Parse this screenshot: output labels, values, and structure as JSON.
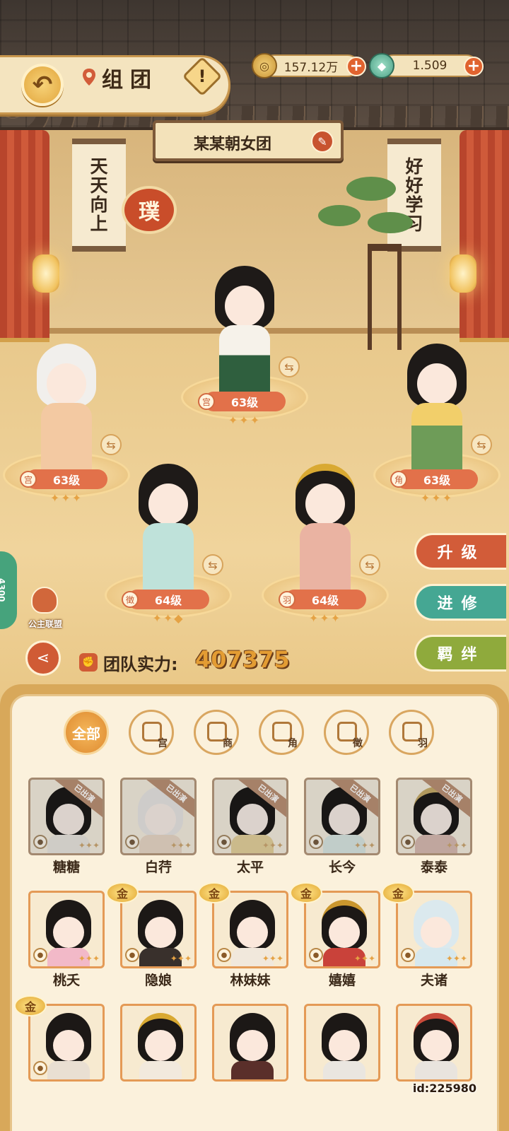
{
  "header": {
    "title": "组团",
    "help_symbol": "!",
    "back_symbol": "↶"
  },
  "resources": {
    "coin": {
      "value": "157.12万",
      "icon": "coin-icon"
    },
    "jade": {
      "value": "1.509",
      "icon": "jade-icon"
    },
    "plus": "+"
  },
  "team": {
    "name": "某某朝女团",
    "edit_icon": "brush-icon"
  },
  "decor": {
    "scroll_left": [
      "天",
      "天",
      "向",
      "上"
    ],
    "scroll_right": [
      "好",
      "好",
      "学",
      "习"
    ],
    "seal": "璞"
  },
  "members": [
    {
      "level": "63级",
      "role": "宫",
      "stars": "✦✦✦"
    },
    {
      "level": "63级",
      "role": "宫",
      "stars": "✦✦✦"
    },
    {
      "level": "63级",
      "role": "角",
      "stars": "✦✦✦"
    },
    {
      "level": "64级",
      "role": "徵",
      "stars": "✦✦◆"
    },
    {
      "level": "64级",
      "role": "羽",
      "stars": "✦✦✦"
    }
  ],
  "actions": {
    "upgrade": "升级",
    "advance": "进修",
    "bond": "羁绊"
  },
  "side": {
    "left_tab": "4300",
    "alliance": "公主联盟"
  },
  "power": {
    "label": "团队实力:",
    "value": "407375"
  },
  "filters": [
    {
      "label": "全部",
      "sub": ""
    },
    {
      "label": "",
      "sub": "宫"
    },
    {
      "label": "",
      "sub": "商"
    },
    {
      "label": "",
      "sub": "角"
    },
    {
      "label": "",
      "sub": "徵"
    },
    {
      "label": "",
      "sub": "羽"
    }
  ],
  "roster": {
    "deployed_label": "已出演",
    "gold_label": "金",
    "rows": [
      [
        {
          "name": "糖糖",
          "deployed": true,
          "gold": false
        },
        {
          "name": "白荇",
          "deployed": true,
          "gold": false
        },
        {
          "name": "太平",
          "deployed": true,
          "gold": false
        },
        {
          "name": "长今",
          "deployed": true,
          "gold": false
        },
        {
          "name": "泰泰",
          "deployed": true,
          "gold": false
        }
      ],
      [
        {
          "name": "桃夭",
          "deployed": false,
          "gold": false
        },
        {
          "name": "隐娘",
          "deployed": false,
          "gold": true
        },
        {
          "name": "林妹妹",
          "deployed": false,
          "gold": true
        },
        {
          "name": "嬉嬉",
          "deployed": false,
          "gold": true
        },
        {
          "name": "夫诸",
          "deployed": false,
          "gold": true
        }
      ],
      [
        {
          "name": "",
          "deployed": false,
          "gold": true
        },
        {
          "name": "",
          "deployed": false,
          "gold": false
        },
        {
          "name": "",
          "deployed": false,
          "gold": false
        },
        {
          "name": "",
          "deployed": false,
          "gold": false
        },
        {
          "name": "",
          "deployed": false,
          "gold": false
        }
      ]
    ]
  },
  "uid": "id:225980",
  "colors": {
    "accent_red": "#d25c39",
    "accent_teal": "#45a793",
    "accent_green": "#8faa3c",
    "gold": "#e39c33"
  }
}
